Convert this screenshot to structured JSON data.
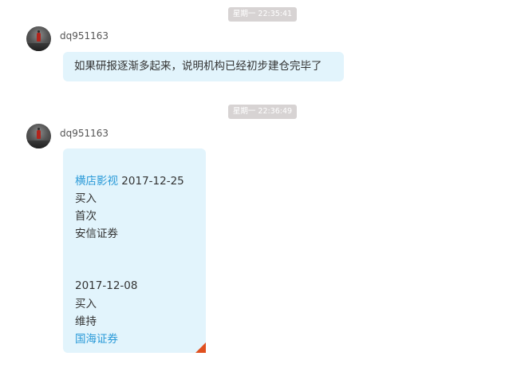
{
  "messages": [
    {
      "timestamp": "星期一 22:35:41",
      "username": "dq951163",
      "text": "如果研报逐渐多起来，说明机构已经初步建仓完毕了"
    },
    {
      "timestamp": "星期一 22:36:49",
      "username": "dq951163",
      "report1": {
        "stock": "横店影视",
        "date": "2017-12-25",
        "action": "买入",
        "rating": "首次",
        "broker": "安信证券"
      },
      "report2": {
        "date": "2017-12-08",
        "action": "买入",
        "rating": "维持",
        "broker": "国海证券"
      }
    }
  ],
  "colors": {
    "bubble": "#e2f4fc",
    "timestamp_bg": "#d7d3d3",
    "link": "#2a9ad8",
    "corner_flag": "#e0501f"
  },
  "icons": {
    "avatar": "avatar-icon",
    "corner": "corner-flag-icon"
  }
}
